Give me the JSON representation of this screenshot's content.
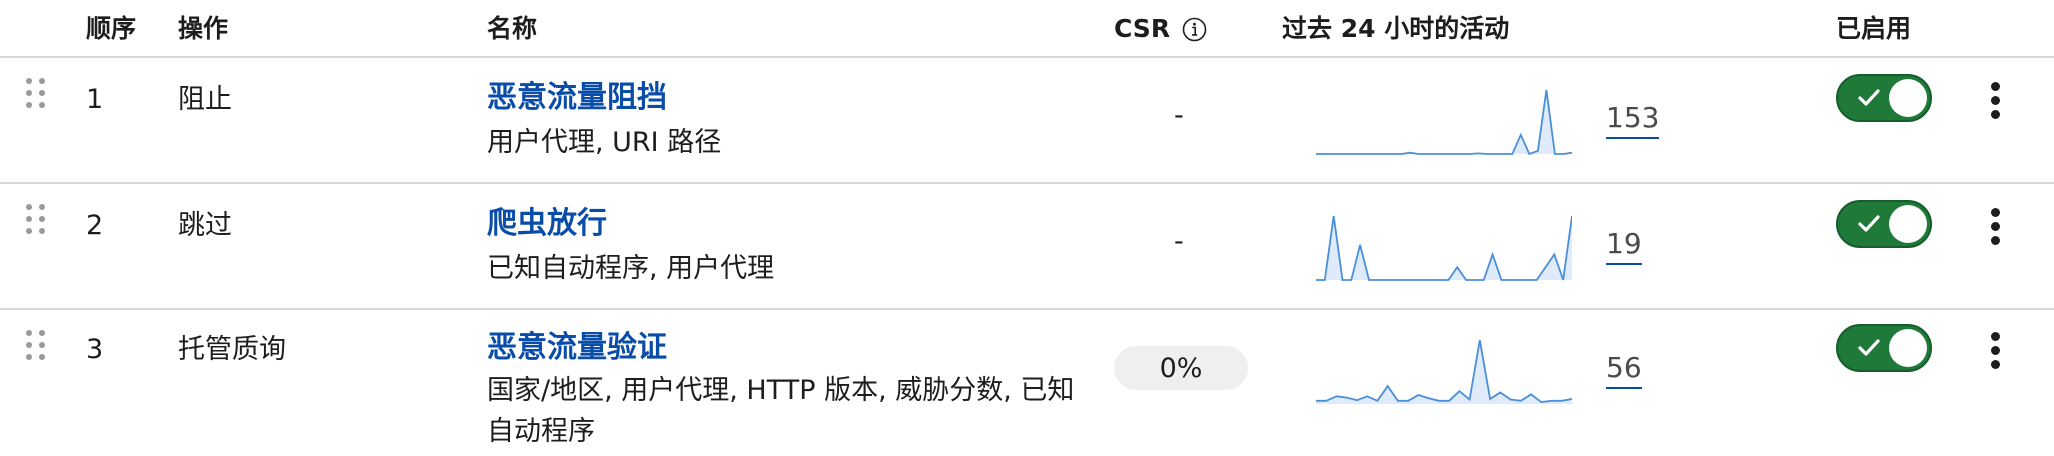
{
  "header": {
    "order": "顺序",
    "action": "操作",
    "name": "名称",
    "csr": "CSR",
    "activity": "过去 24 小时的活动",
    "enabled": "已启用"
  },
  "colors": {
    "link_blue": "#0a4da8",
    "toggle_green": "#1f7a3a",
    "spark_line": "#4a8fd9",
    "spark_fill": "#dfeafa"
  },
  "rules": [
    {
      "order": "1",
      "action": "阻止",
      "name": "恶意流量阻挡",
      "description": "用户代理, URI 路径",
      "csr": "-",
      "activity_count": "153",
      "activity": [
        0,
        0,
        0,
        0,
        0,
        0,
        0,
        0,
        0,
        0,
        0,
        0.02,
        0,
        0,
        0,
        0,
        0,
        0,
        0,
        0.01,
        0,
        0,
        0,
        0,
        0.3,
        0,
        0.05,
        1,
        0,
        0,
        0.02
      ],
      "enabled": true
    },
    {
      "order": "2",
      "action": "跳过",
      "name": "爬虫放行",
      "description": "已知自动程序, 用户代理",
      "csr": "-",
      "activity_count": "19",
      "activity": [
        0,
        0,
        1,
        0,
        0,
        0.55,
        0,
        0,
        0,
        0,
        0,
        0,
        0,
        0,
        0,
        0,
        0.2,
        0,
        0,
        0,
        0.4,
        0,
        0,
        0,
        0,
        0,
        0.2,
        0.4,
        0,
        1
      ],
      "enabled": true
    },
    {
      "order": "3",
      "action": "托管质询",
      "name": "恶意流量验证",
      "description": "国家/地区, 用户代理, HTTP 版本, 威胁分数, 已知自动程序",
      "csr": "0%",
      "activity_count": "56",
      "activity": [
        0.05,
        0.05,
        0.12,
        0.1,
        0.06,
        0.12,
        0.05,
        0.28,
        0.05,
        0.05,
        0.14,
        0.09,
        0.05,
        0.05,
        0.2,
        0.07,
        1,
        0.08,
        0.18,
        0.07,
        0.05,
        0.15,
        0.03,
        0.05,
        0.05,
        0.08
      ],
      "enabled": true
    }
  ]
}
